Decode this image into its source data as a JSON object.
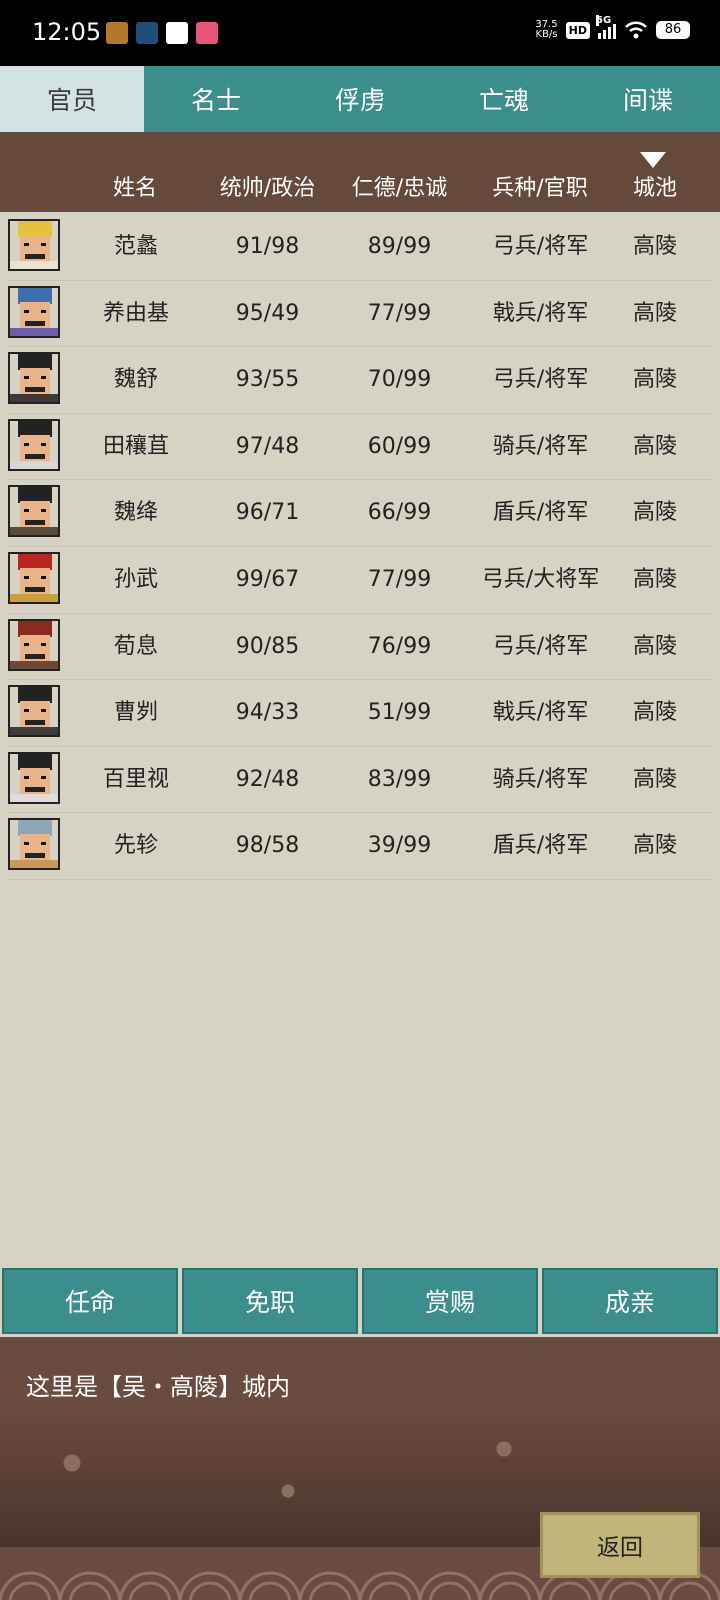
{
  "status": {
    "time": "12:05",
    "net_speed": "37.5",
    "net_unit": "KB/s",
    "hd": "HD",
    "net_type": "5G",
    "battery": "86"
  },
  "tabs": [
    {
      "label": "官员"
    },
    {
      "label": "名士"
    },
    {
      "label": "俘虏"
    },
    {
      "label": "亡魂"
    },
    {
      "label": "间谍"
    }
  ],
  "header": {
    "name": "姓名",
    "lead_pol": "统帅/政治",
    "virtue_loyal": "仁德/忠诚",
    "troop_rank": "兵种/官职",
    "city": "城池"
  },
  "officers": [
    {
      "name": "范蠡",
      "lead_pol": "91/98",
      "virtue_loyal": "89/99",
      "troop_rank": "弓兵/将军",
      "city": "高陵"
    },
    {
      "name": "养由基",
      "lead_pol": "95/49",
      "virtue_loyal": "77/99",
      "troop_rank": "戟兵/将军",
      "city": "高陵"
    },
    {
      "name": "魏舒",
      "lead_pol": "93/55",
      "virtue_loyal": "70/99",
      "troop_rank": "弓兵/将军",
      "city": "高陵"
    },
    {
      "name": "田穰苴",
      "lead_pol": "97/48",
      "virtue_loyal": "60/99",
      "troop_rank": "骑兵/将军",
      "city": "高陵"
    },
    {
      "name": "魏绛",
      "lead_pol": "96/71",
      "virtue_loyal": "66/99",
      "troop_rank": "盾兵/将军",
      "city": "高陵"
    },
    {
      "name": "孙武",
      "lead_pol": "99/67",
      "virtue_loyal": "77/99",
      "troop_rank": "弓兵/大将军",
      "city": "高陵"
    },
    {
      "name": "荀息",
      "lead_pol": "90/85",
      "virtue_loyal": "76/99",
      "troop_rank": "弓兵/将军",
      "city": "高陵"
    },
    {
      "name": "曹刿",
      "lead_pol": "94/33",
      "virtue_loyal": "51/99",
      "troop_rank": "戟兵/将军",
      "city": "高陵"
    },
    {
      "name": "百里视",
      "lead_pol": "92/48",
      "virtue_loyal": "83/99",
      "troop_rank": "骑兵/将军",
      "city": "高陵"
    },
    {
      "name": "先轸",
      "lead_pol": "98/58",
      "virtue_loyal": "39/99",
      "troop_rank": "盾兵/将军",
      "city": "高陵"
    }
  ],
  "actions": {
    "appoint": "任命",
    "dismiss": "免职",
    "reward": "赏赐",
    "marry": "成亲"
  },
  "message": "这里是【吴・高陵】城内",
  "back_label": "返回",
  "colors": {
    "tab_bar": "#3b8e8c",
    "tab_active": "#d3e3e3",
    "header": "#65493a",
    "background": "#d7d3c4",
    "back_button": "#c2b57a"
  }
}
